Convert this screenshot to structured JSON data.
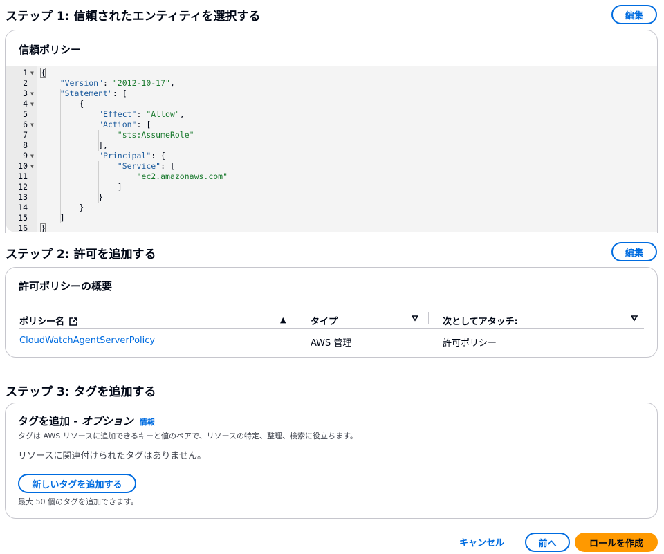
{
  "step1": {
    "title": "ステップ 1: 信頼されたエンティティを選択する",
    "edit_label": "編集",
    "card_title": "信頼ポリシー",
    "code_lines": [
      "{",
      "    \"Version\": \"2012-10-17\",",
      "    \"Statement\": [",
      "        {",
      "            \"Effect\": \"Allow\",",
      "            \"Action\": [",
      "                \"sts:AssumeRole\"",
      "            ],",
      "            \"Principal\": {",
      "                \"Service\": [",
      "                    \"ec2.amazonaws.com\"",
      "                ]",
      "            }",
      "        }",
      "    ]",
      "}"
    ],
    "line_numbers": [
      "1",
      "2",
      "3",
      "4",
      "5",
      "6",
      "7",
      "8",
      "9",
      "10",
      "11",
      "12",
      "13",
      "14",
      "15",
      "16"
    ]
  },
  "step2": {
    "title": "ステップ 2: 許可を追加する",
    "edit_label": "編集",
    "card_title": "許可ポリシーの概要",
    "columns": [
      "ポリシー名",
      "タイプ",
      "次としてアタッチ:"
    ],
    "rows": [
      {
        "name": "CloudWatchAgentServerPolicy",
        "type": "AWS 管理",
        "attached_as": "許可ポリシー"
      }
    ]
  },
  "step3": {
    "title": "ステップ 3: タグを追加する",
    "card_title_main": "タグを追加 - ",
    "card_title_italic": "オプション",
    "info_label": "情報",
    "description": "タグは AWS リソースに追加できるキーと値のペアで、リソースの特定、整理、検索に役立ちます。",
    "empty_message": "リソースに関連付けられたタグはありません。",
    "add_tag_label": "新しいタグを追加する",
    "limit_note": "最大 50 個のタグを追加できます。"
  },
  "footer": {
    "cancel_label": "キャンセル",
    "prev_label": "前へ",
    "create_label": "ロールを作成"
  },
  "colors": {
    "link": "#006ce0",
    "primary": "#ff9900",
    "border": "#c6c6cd",
    "json_key": "#1c5b9d",
    "json_string": "#1a7a2e"
  }
}
